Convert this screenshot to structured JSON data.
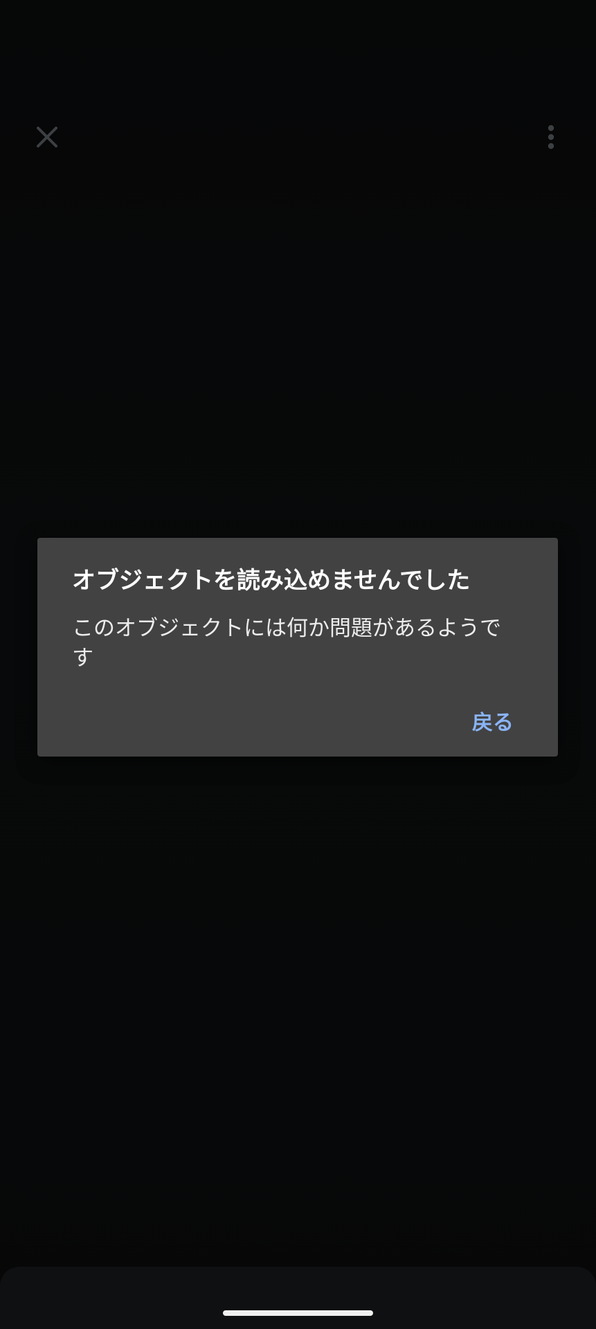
{
  "appbar": {
    "close_icon": "close-icon",
    "more_icon": "more-vert-icon"
  },
  "dialog": {
    "title": "オブジェクトを読み込めませんでした",
    "message": "このオブジェクトには何か問題があるようです",
    "action_label": "戻る"
  },
  "colors": {
    "dialog_bg": "#424242",
    "action_text": "#8ab4f8",
    "icon": "#5f6368"
  }
}
